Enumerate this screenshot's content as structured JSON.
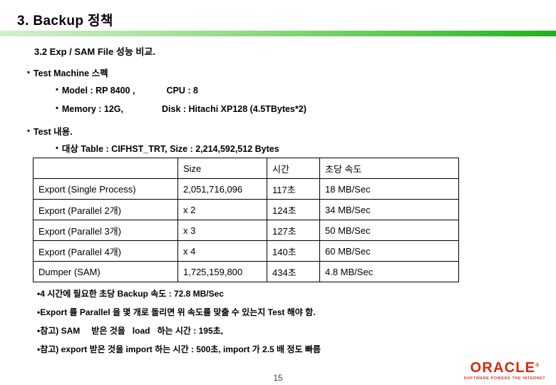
{
  "slide": {
    "title": "3. Backup 정책",
    "subtitle": "3.2 Exp / SAM File 성능 비교.",
    "page_number": "15",
    "accent_green": "#2fb92a",
    "accent_red": "#d6290d"
  },
  "spec": {
    "heading": "Test Machine 스펙",
    "model_label": "Model : RP 8400 ,",
    "cpu_label": "CPU   : 8",
    "memory_label": "Memory : 12G,",
    "disk_label": "Disk : Hitachi XP128 (4.5TBytes*2)"
  },
  "test": {
    "heading": "Test 내용.",
    "target": "대상 Table : CIFHST_TRT, Size : 2,214,592,512 Bytes"
  },
  "table": {
    "headers": [
      "",
      "Size",
      "시간",
      "초당 속도"
    ],
    "rows": [
      {
        "label": "Export (Single Process)",
        "size": "2,051,716,096",
        "time": "117초",
        "rate": "18 MB/Sec"
      },
      {
        "label": "Export (Parallel 2개)",
        "size": "x 2",
        "time": "124초",
        "rate": "34 MB/Sec"
      },
      {
        "label": "Export (Parallel 3개)",
        "size": "x 3",
        "time": "127초",
        "rate": "50 MB/Sec"
      },
      {
        "label": "Export (Parallel 4개)",
        "size": "x 4",
        "time": "140초",
        "rate": "60 MB/Sec"
      },
      {
        "label": "Dumper (SAM)",
        "size": "1,725,159,800",
        "time": "434초",
        "rate": "4.8 MB/Sec"
      }
    ]
  },
  "notes": [
    "4 시간에 필요한 초당 Backup 속도 : 72.8 MB/Sec",
    "Export 를 Parallel 을 몇 개로 돌리면 위 속도를 맞출 수 있는지 Test 해야 함.",
    "참고) SAM",
    "받은 것을",
    "load",
    "하는 시간 : 195초,",
    "참고) export 받은 것을 import 하는 시간 : 500초, import 가 2.5 배 정도 빠름"
  ],
  "logo": {
    "wordmark": "ORACLE",
    "registered": "®",
    "tagline": "SOFTWARE POWERS THE INTERNET"
  },
  "bullets": {
    "glyph": "•"
  }
}
